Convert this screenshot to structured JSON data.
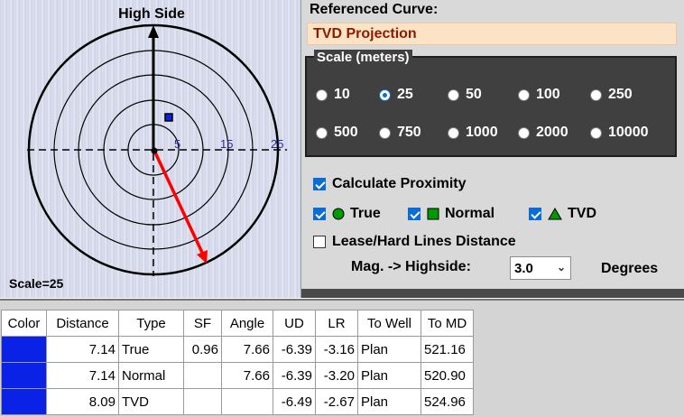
{
  "plot": {
    "high_side_label": "High Side",
    "scale_caption": "Scale=25",
    "ring_labels": [
      "5",
      "15",
      "25"
    ]
  },
  "referenced_curve": {
    "label": "Referenced Curve:",
    "value": "TVD Projection"
  },
  "scale_group": {
    "legend": "Scale (meters)",
    "options": [
      "10",
      "25",
      "50",
      "100",
      "250",
      "500",
      "750",
      "1000",
      "2000",
      "10000"
    ],
    "selected": "25"
  },
  "proximity": {
    "calculate_label": "Calculate Proximity",
    "calculate_checked": true,
    "true_label": "True",
    "normal_label": "Normal",
    "tvd_label": "TVD",
    "lease_label": "Lease/Hard Lines Distance",
    "lease_checked": false
  },
  "magnetic": {
    "label": "Mag. -> Highside:",
    "value": "3.0",
    "units": "Degrees"
  },
  "table": {
    "headers": [
      "Color",
      "Distance",
      "Type",
      "SF",
      "Angle",
      "UD",
      "LR",
      "To Well",
      "To MD"
    ],
    "rows": [
      {
        "color": "#0a21e6",
        "distance": "7.14",
        "type": "True",
        "sf": "0.96",
        "angle": "7.66",
        "ud": "-6.39",
        "lr": "-3.16",
        "to_well": "Plan",
        "to_md": "521.16"
      },
      {
        "color": "#0a21e6",
        "distance": "7.14",
        "type": "Normal",
        "sf": "",
        "angle": "7.66",
        "ud": "-6.39",
        "lr": "-3.20",
        "to_well": "Plan",
        "to_md": "520.90"
      },
      {
        "color": "#0a21e6",
        "distance": "8.09",
        "type": "TVD",
        "sf": "",
        "angle": "",
        "ud": "-6.49",
        "lr": "-2.67",
        "to_well": "Plan",
        "to_md": "524.96"
      }
    ]
  },
  "colors": {
    "arrow": "#ff0000",
    "accent": "#0a6cd6",
    "well_marker": "#0a21e6",
    "checkbox_shape": "#009900"
  }
}
